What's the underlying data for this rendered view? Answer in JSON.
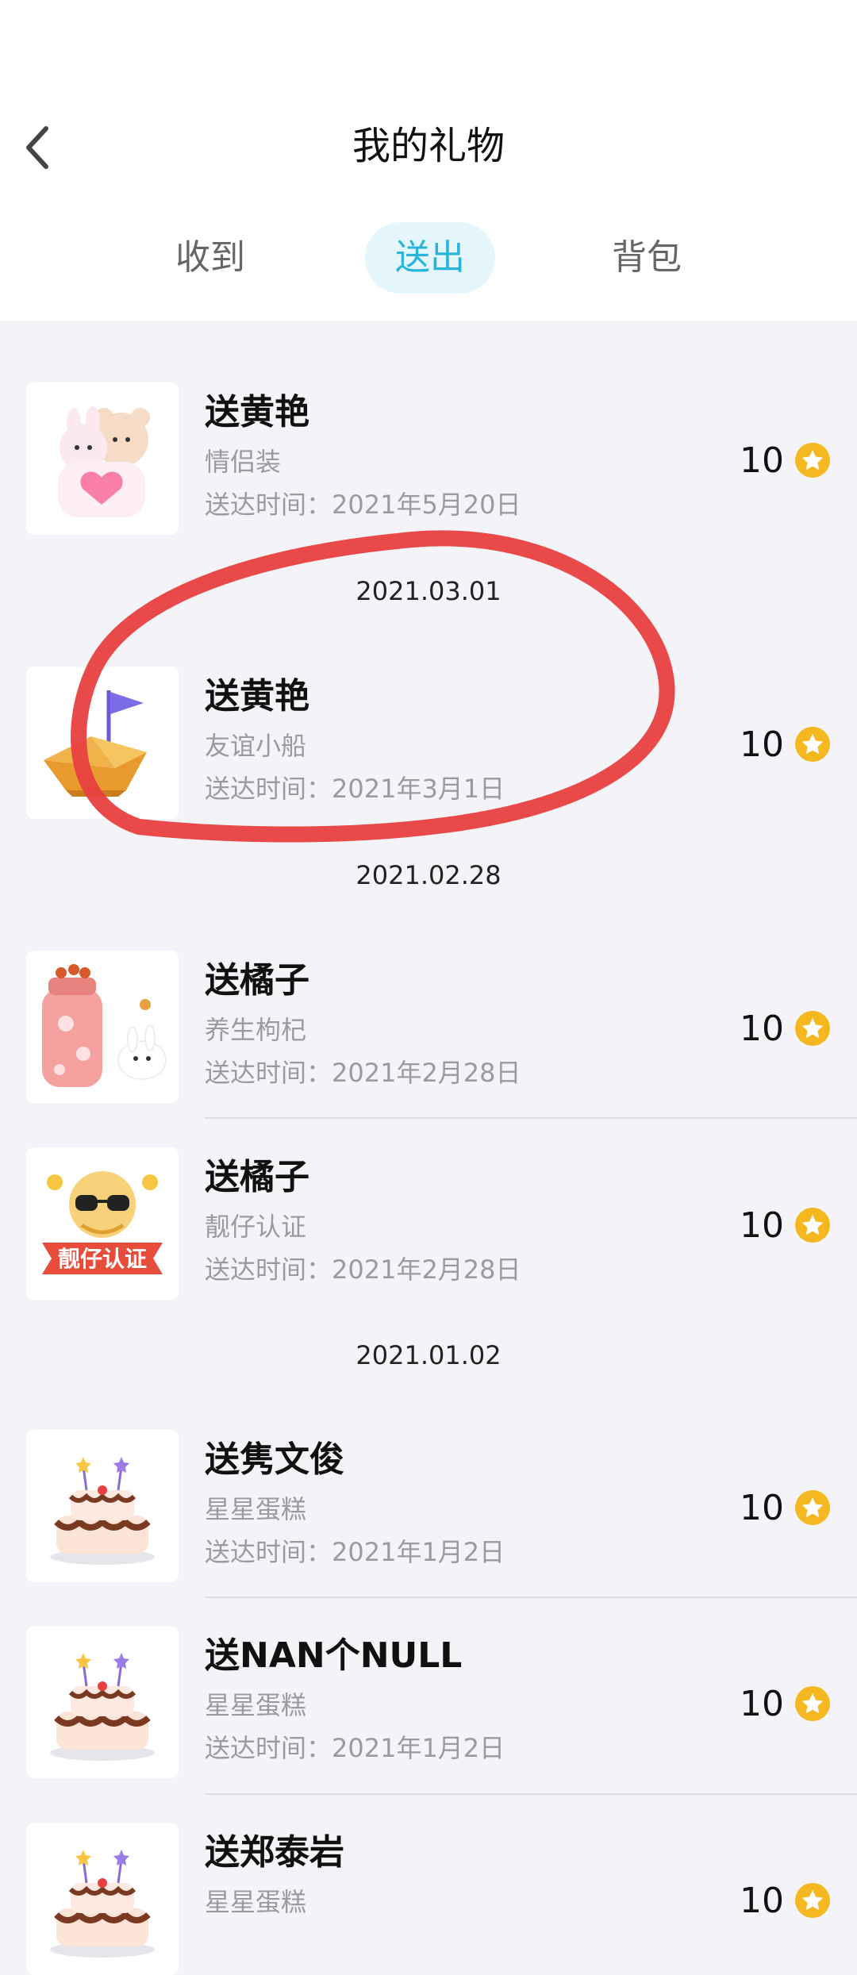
{
  "header": {
    "title": "我的礼物",
    "back_icon": "chevron-left-icon"
  },
  "tabs": [
    {
      "label": "收到",
      "active": false
    },
    {
      "label": "送出",
      "active": true
    },
    {
      "label": "背包",
      "active": false
    }
  ],
  "colors": {
    "accent": "#2ab4d9",
    "tab_active_bg": "#e4f6fb",
    "coin": "#f5b820",
    "annotation": "#e8403f"
  },
  "groups": [
    {
      "date": "",
      "items": [
        {
          "name": "送黄艳",
          "gift": "情侣装",
          "time": "送达时间：2021年5月20日",
          "price": "10",
          "icon": "couple-bears-icon"
        }
      ]
    },
    {
      "date": "2021.03.01",
      "items": [
        {
          "name": "送黄艳",
          "gift": "友谊小船",
          "time": "送达时间：2021年3月1日",
          "price": "10",
          "icon": "paper-boat-icon"
        }
      ]
    },
    {
      "date": "2021.02.28",
      "items": [
        {
          "name": "送橘子",
          "gift": "养生枸杞",
          "time": "送达时间：2021年2月28日",
          "price": "10",
          "icon": "thermos-bottle-icon"
        },
        {
          "name": "送橘子",
          "gift": "靓仔认证",
          "time": "送达时间：2021年2月28日",
          "price": "10",
          "icon": "handsome-badge-icon",
          "badge_text": "靓仔认证"
        }
      ]
    },
    {
      "date": "2021.01.02",
      "items": [
        {
          "name": "送隽文俊",
          "gift": "星星蛋糕",
          "time": "送达时间：2021年1月2日",
          "price": "10",
          "icon": "star-cake-icon"
        },
        {
          "name": "送NAN个NULL",
          "gift": "星星蛋糕",
          "time": "送达时间：2021年1月2日",
          "price": "10",
          "icon": "star-cake-icon"
        },
        {
          "name": "送郑泰岩",
          "gift": "星星蛋糕",
          "time": "",
          "price": "10",
          "icon": "star-cake-icon"
        }
      ]
    }
  ]
}
